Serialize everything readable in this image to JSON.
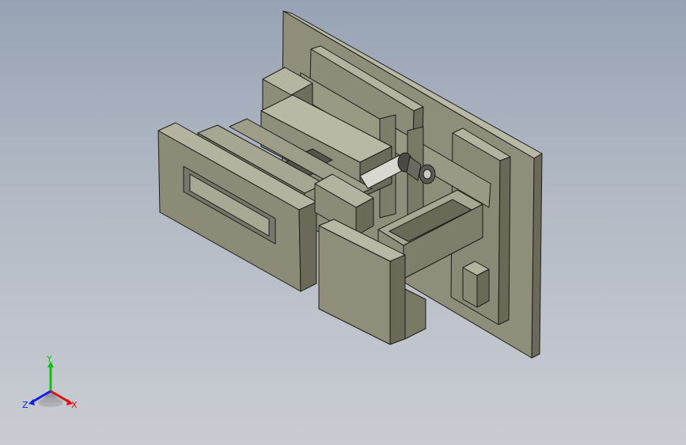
{
  "viewport": {
    "background_top": "#97a3b4",
    "background_bottom": "#c9ccd2",
    "model_color": "#8c8b77",
    "edge_color": "#1c1c1c"
  },
  "triad": {
    "x_label": "X",
    "y_label": "Y",
    "z_label": "Z",
    "x_color": "#e01010",
    "y_color": "#10c010",
    "z_color": "#1020e0"
  }
}
